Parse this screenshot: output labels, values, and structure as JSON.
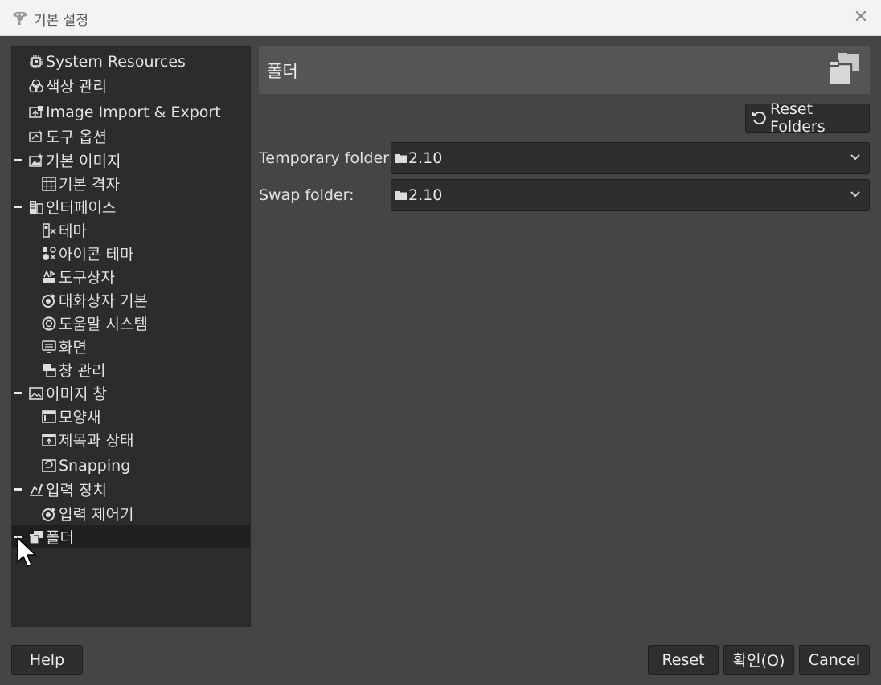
{
  "window": {
    "title": "기본 설정",
    "close_glyph": "✕",
    "app_icon": "gimp-icon"
  },
  "sidebar": {
    "items": [
      {
        "label": "System Resources",
        "icon": "chip-icon",
        "level": 0,
        "expander": false
      },
      {
        "label": "색상 관리",
        "icon": "color-circles-icon",
        "level": 0,
        "expander": false
      },
      {
        "label": "Image Import & Export",
        "icon": "image-import-icon",
        "level": 0,
        "expander": false
      },
      {
        "label": "도구 옵션",
        "icon": "tool-options-icon",
        "level": 0,
        "expander": false
      },
      {
        "label": "기본 이미지",
        "icon": "default-image-icon",
        "level": 0,
        "expander": true
      },
      {
        "label": "기본 격자",
        "icon": "grid-icon",
        "level": 1,
        "expander": false
      },
      {
        "label": "인터페이스",
        "icon": "interface-icon",
        "level": 0,
        "expander": true
      },
      {
        "label": "테마",
        "icon": "theme-icon",
        "level": 1,
        "expander": false
      },
      {
        "label": "아이콘 테마",
        "icon": "icon-theme-icon",
        "level": 1,
        "expander": false
      },
      {
        "label": "도구상자",
        "icon": "toolbox-icon",
        "level": 1,
        "expander": false
      },
      {
        "label": "대화상자 기본",
        "icon": "dialog-defaults-icon",
        "level": 1,
        "expander": false
      },
      {
        "label": "도움말 시스템",
        "icon": "help-system-icon",
        "level": 1,
        "expander": false
      },
      {
        "label": "화면",
        "icon": "display-icon",
        "level": 1,
        "expander": false
      },
      {
        "label": "창 관리",
        "icon": "window-management-icon",
        "level": 1,
        "expander": false
      },
      {
        "label": "이미지 창",
        "icon": "image-window-icon",
        "level": 0,
        "expander": true
      },
      {
        "label": "모양새",
        "icon": "appearance-icon",
        "level": 1,
        "expander": false
      },
      {
        "label": "제목과 상태",
        "icon": "title-status-icon",
        "level": 1,
        "expander": false
      },
      {
        "label": "Snapping",
        "icon": "snapping-icon",
        "level": 1,
        "expander": false
      },
      {
        "label": "입력 장치",
        "icon": "input-devices-icon",
        "level": 0,
        "expander": true
      },
      {
        "label": "입력 제어기",
        "icon": "input-controllers-icon",
        "level": 1,
        "expander": false
      },
      {
        "label": "폴더",
        "icon": "folders-icon",
        "level": 0,
        "expander": true,
        "selected": true
      }
    ]
  },
  "main": {
    "title": "폴더",
    "header_icon": "folders-icon",
    "reset_folders_label": "Reset Folders",
    "reset_icon": "reset-icon",
    "fields": [
      {
        "label": "Temporary folder:",
        "value": "2.10"
      },
      {
        "label": "Swap folder:",
        "value": "2.10"
      }
    ]
  },
  "footer": {
    "help_label": "Help",
    "reset_label": "Reset",
    "ok_label": "확인(O)",
    "cancel_label": "Cancel"
  }
}
